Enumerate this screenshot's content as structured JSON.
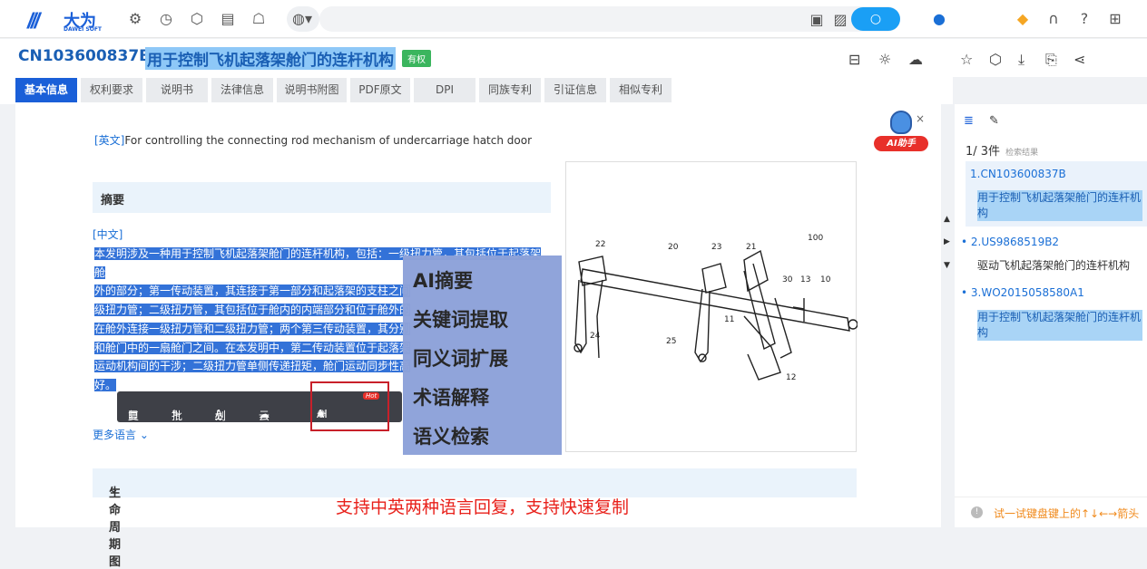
{
  "topbar": {
    "logo_name": "大为",
    "logo_sub": "DAWEI SOFT"
  },
  "header": {
    "patent_number": "CN103600837B",
    "patent_title": "用于控制飞机起落架舱门的连杆机构",
    "status_badge": "有权"
  },
  "tabs": [
    {
      "label": "基本信息",
      "active": true
    },
    {
      "label": "权利要求"
    },
    {
      "label": "说明书"
    },
    {
      "label": "法律信息"
    },
    {
      "label": "说明书附图"
    },
    {
      "label": "PDF原文"
    },
    {
      "label": "DPI"
    },
    {
      "label": "同族专利"
    },
    {
      "label": "引证信息"
    },
    {
      "label": "相似专利"
    }
  ],
  "main": {
    "english_tag": "[英文]",
    "english_title": "For controlling the connecting rod mechanism of undercarriage hatch door",
    "ai_helper_label": "AI助手",
    "abstract_heading": "摘要",
    "chinese_tag": "[中文]",
    "abstract_lines": [
      "本发明涉及一种用于控制飞机起落架舱门的连杆机构，包括：一级扭力管，其包括位于起落架舱",
      "外的部分；第一传动装置，其连接于第一部分和起落架的支柱之间",
      "级扭力管；二级扭力管，其包括位于舱内的内端部分和位于舱外的",
      "在舱外连接一级扭力管和二级扭力管；两个第三传动装置，其分别",
      "和舱门中的一扇舱门之间。在本发明中，第二传动装置位于起落架",
      "运动机构间的干涉；二级扭力管单侧传递扭矩，舱门运动同步性高",
      "好。"
    ],
    "more_languages": "更多语言",
    "lifecycle_heading": "生命周期图",
    "caption": "支持中英两种语言回复，支持快速复制"
  },
  "popup_menu": [
    "AI摘要",
    "关键词提取",
    "同义词扩展",
    "术语解释",
    "语义检索"
  ],
  "toolbar": {
    "copy": "复制",
    "annotate": "批注",
    "underline": "划线",
    "cloud_note": "云笔记",
    "ai_helper": "AI助手",
    "hot": "Hot"
  },
  "figure_labels": [
    "22",
    "20",
    "23",
    "21",
    "100",
    "30",
    "13",
    "10",
    "11",
    "24",
    "25",
    "12"
  ],
  "right_panel": {
    "count": "1/ 3件",
    "count_sub": "检索结果",
    "results": [
      {
        "num": "1.CN103600837B",
        "title": "用于控制飞机起落架舱门的连杆机构"
      },
      {
        "num": "2.US9868519B2",
        "title": "驱动飞机起落架舱门的连杆机构"
      },
      {
        "num": "3.WO2015058580A1",
        "title": "用于控制飞机起落架舱门的连杆机构"
      }
    ],
    "hint": "试一试键盘键上的↑↓←→箭头"
  }
}
